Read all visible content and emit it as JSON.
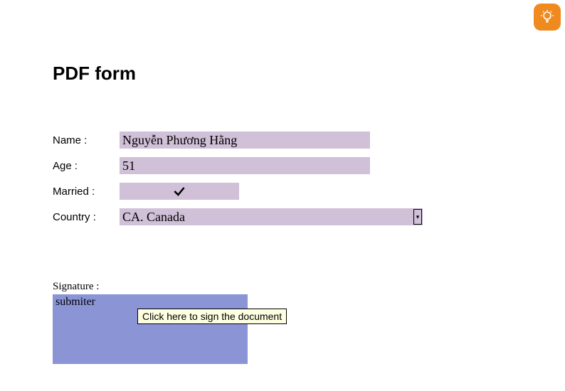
{
  "title": "PDF form",
  "form": {
    "name_label": "Name :",
    "name_value": "Nguyễn Phương Hằng",
    "age_label": "Age :",
    "age_value": "51",
    "married_label": "Married :",
    "married_checked": true,
    "country_label": "Country :",
    "country_value": "CA. Canada"
  },
  "signature": {
    "label": "Signature :",
    "placeholder_text": "submiter"
  },
  "tooltip": "Click here to sign the document",
  "icons": {
    "hint": "lightbulb-icon",
    "check": "check-icon",
    "dropdown": "chevron-down-icon"
  }
}
